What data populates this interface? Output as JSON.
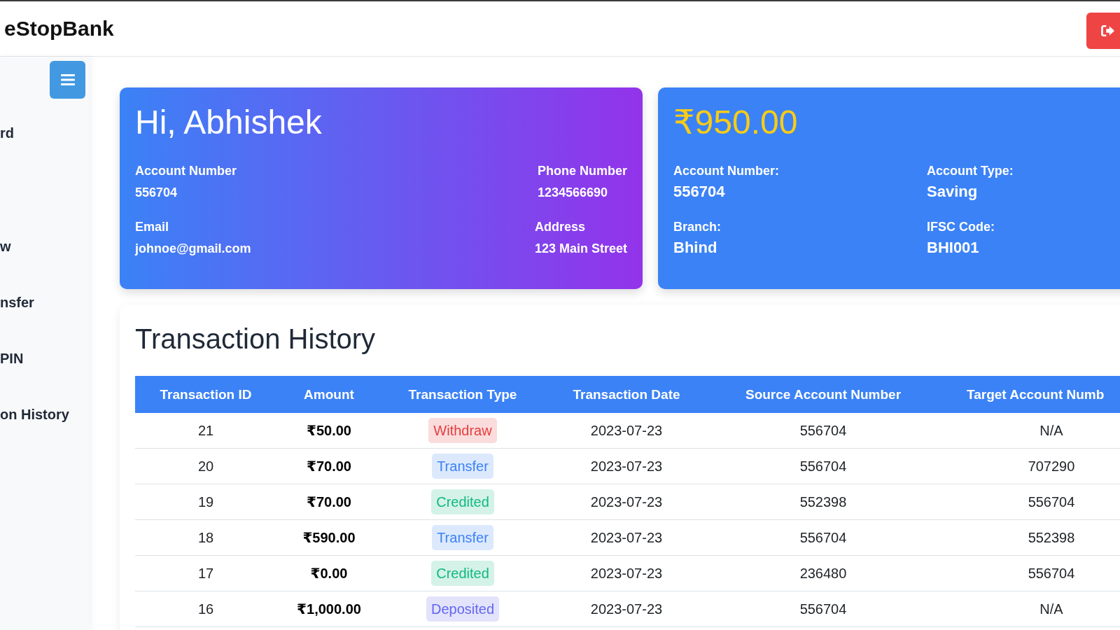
{
  "header": {
    "brand": "eStopBank"
  },
  "sidebar": {
    "items": [
      "rd",
      "w",
      "nsfer",
      "PIN",
      "on History"
    ]
  },
  "profile_card": {
    "greeting": "Hi, Abhishek",
    "fields": [
      {
        "label": "Account Number",
        "value": "556704"
      },
      {
        "label": "Phone Number",
        "value": "1234566690"
      },
      {
        "label": "Email",
        "value": "johnoe@gmail.com"
      },
      {
        "label": "Address",
        "value": "123 Main Street"
      }
    ]
  },
  "account_card": {
    "balance": "₹950.00",
    "fields": [
      {
        "label": "Account Number:",
        "value": "556704"
      },
      {
        "label": "Account Type:",
        "value": "Saving"
      },
      {
        "label": "Branch:",
        "value": "Bhind"
      },
      {
        "label": "IFSC Code:",
        "value": "BHI001"
      }
    ]
  },
  "transactions": {
    "title": "Transaction History",
    "columns": [
      "Transaction ID",
      "Amount",
      "Transaction Type",
      "Transaction Date",
      "Source Account Number",
      "Target Account Numb"
    ],
    "rows": [
      {
        "id": "21",
        "amount": "₹50.00",
        "type": "Withdraw",
        "color": "#e53e3e",
        "date": "2023-07-23",
        "source": "556704",
        "target": "N/A"
      },
      {
        "id": "20",
        "amount": "₹70.00",
        "type": "Transfer",
        "color": "#3b82f6",
        "date": "2023-07-23",
        "source": "556704",
        "target": "707290"
      },
      {
        "id": "19",
        "amount": "₹70.00",
        "type": "Credited",
        "color": "#10b981",
        "date": "2023-07-23",
        "source": "552398",
        "target": "556704"
      },
      {
        "id": "18",
        "amount": "₹590.00",
        "type": "Transfer",
        "color": "#3b82f6",
        "date": "2023-07-23",
        "source": "556704",
        "target": "552398"
      },
      {
        "id": "17",
        "amount": "₹0.00",
        "type": "Credited",
        "color": "#10b981",
        "date": "2023-07-23",
        "source": "236480",
        "target": "556704"
      },
      {
        "id": "16",
        "amount": "₹1,000.00",
        "type": "Deposited",
        "color": "#6366f1",
        "date": "2023-07-23",
        "source": "556704",
        "target": "N/A"
      }
    ]
  }
}
